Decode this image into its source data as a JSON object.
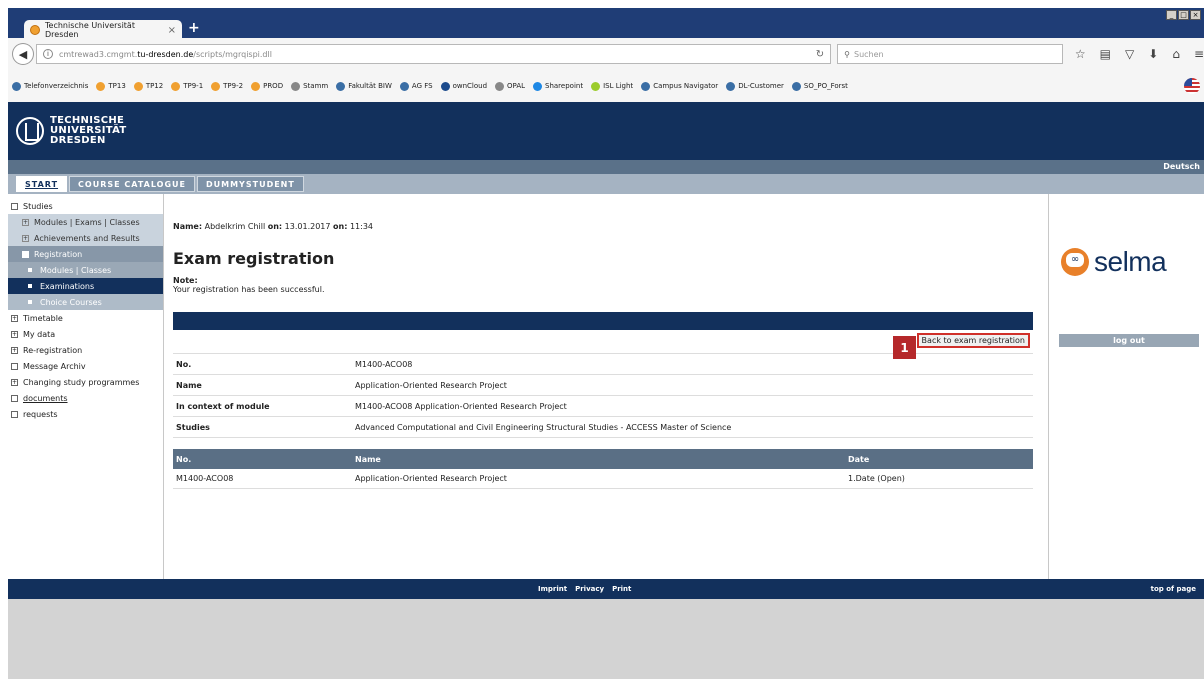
{
  "browser": {
    "tab_title": "Technische Universität Dresden",
    "tab_close": "×",
    "new_tab": "+",
    "url_prefix": "cmtrewad3.cmgmt.",
    "url_domain": "tu-dresden.de",
    "url_path": "/scripts/mgrqispi.dll",
    "search_placeholder": "Suchen",
    "bookmarks": [
      {
        "label": "Telefonverzeichnis",
        "color": "#3a6ea5"
      },
      {
        "label": "TP13",
        "color": "#f0a030"
      },
      {
        "label": "TP12",
        "color": "#f0a030"
      },
      {
        "label": "TP9-1",
        "color": "#f0a030"
      },
      {
        "label": "TP9-2",
        "color": "#f0a030"
      },
      {
        "label": "PROD",
        "color": "#f0a030"
      },
      {
        "label": "Stamm",
        "color": "#888888"
      },
      {
        "label": "Fakultät BIW",
        "color": "#3a6ea5"
      },
      {
        "label": "AG FS",
        "color": "#3a6ea5"
      },
      {
        "label": "ownCloud",
        "color": "#1c4b8c"
      },
      {
        "label": "OPAL",
        "color": "#888888"
      },
      {
        "label": "Sharepoint",
        "color": "#1e88e5"
      },
      {
        "label": "ISL Light",
        "color": "#9ccc2c"
      },
      {
        "label": "Campus Navigator",
        "color": "#3a6ea5"
      },
      {
        "label": "DL-Customer",
        "color": "#3a6ea5"
      },
      {
        "label": "SO_PO_Forst",
        "color": "#3a6ea5"
      }
    ]
  },
  "header": {
    "logo_line1": "TECHNISCHE",
    "logo_line2": "UNIVERSITÄT",
    "logo_line3": "DRESDEN",
    "language": "Deutsch"
  },
  "menu": {
    "tabs": [
      "START",
      "COURSE CATALOGUE",
      "DUMMYSTUDENT"
    ]
  },
  "sidebar": {
    "items": [
      {
        "label": "Studies",
        "level": 0,
        "box": ""
      },
      {
        "label": "Modules | Exams | Classes",
        "level": 1
      },
      {
        "label": "Achievements and Results",
        "level": 1
      },
      {
        "label": "Registration",
        "level": 1
      },
      {
        "label": "Modules | Classes",
        "level": 2
      },
      {
        "label": "Examinations",
        "level": 2
      },
      {
        "label": "Choice Courses",
        "level": 2
      },
      {
        "label": "Timetable",
        "level": 0,
        "box": "+"
      },
      {
        "label": "My data",
        "level": 0,
        "box": "+"
      },
      {
        "label": "Re-registration",
        "level": 0,
        "box": "+"
      },
      {
        "label": "Message Archiv",
        "level": 0,
        "box": ""
      },
      {
        "label": "Changing study programmes",
        "level": 0,
        "box": "+"
      },
      {
        "label": "documents",
        "level": 0,
        "box": ""
      },
      {
        "label": "requests",
        "level": 0,
        "box": ""
      }
    ]
  },
  "main": {
    "name_label": "Name:",
    "name_value": "Abdelkrim Chill",
    "on_label1": "on:",
    "date_value": "13.01.2017",
    "on_label2": "on:",
    "time_value": "11:34",
    "title": "Exam registration",
    "note_label": "Note:",
    "note_text": "Your registration has been successful.",
    "back_button": "Back to exam registration",
    "marker": "1",
    "details": [
      {
        "key": "No.",
        "value": "M1400-ACO08"
      },
      {
        "key": "Name",
        "value": "Application-Oriented Research Project"
      },
      {
        "key": "In context of module",
        "value": "M1400-ACO08 Application-Oriented Research Project"
      },
      {
        "key": "Studies",
        "value": "Advanced Computational and Civil Engineering Structural Studies - ACCESS Master of Science"
      }
    ],
    "table": {
      "headers": [
        "No.",
        "Name",
        "Date"
      ],
      "rows": [
        [
          "M1400-ACO08",
          "Application-Oriented Research Project",
          "1.Date (Open)"
        ]
      ]
    }
  },
  "right": {
    "brand": "selma",
    "logout": "log out"
  },
  "footer": {
    "links": [
      "Imprint",
      "Privacy",
      "Print"
    ],
    "top": "top of page"
  }
}
